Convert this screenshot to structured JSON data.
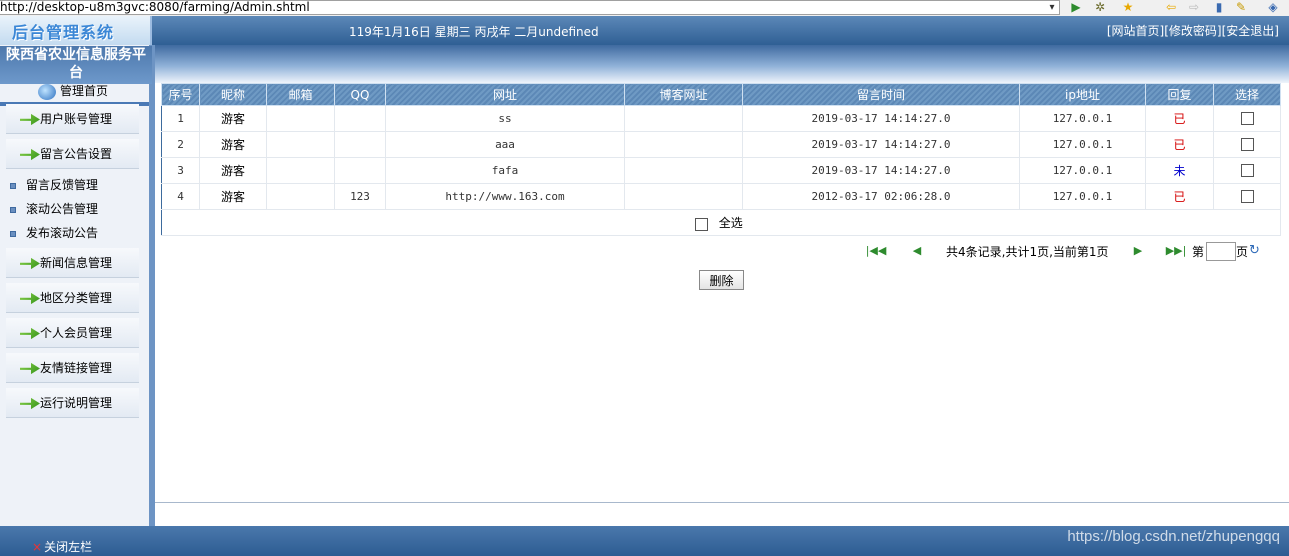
{
  "browser": {
    "address": "http://desktop-u8m3gvc:8080/farming/Admin.shtml",
    "address_dropdown": "▾",
    "toolbar_icons": [
      "go-icon",
      "settings-icon",
      "favorites-icon",
      "back-icon",
      "forward-icon",
      "page-icon",
      "tools-icon",
      "help-icon"
    ]
  },
  "header": {
    "logo": "后台管理系统",
    "date_line": "119年1月16日 星期三 丙戌年 二月undefined",
    "links": [
      "[网站首页]",
      "[修改密码]",
      "[安全退出]"
    ]
  },
  "sidebar": {
    "site_name": "陕西省农业信息服务平台",
    "home_label": "管理首页",
    "menu": [
      {
        "label": "用户账号管理"
      },
      {
        "label": "留言公告设置"
      }
    ],
    "sub_items": [
      "留言反馈管理",
      "滚动公告管理",
      "发布滚动公告"
    ],
    "menu_more": [
      "新闻信息管理",
      "地区分类管理",
      "个人会员管理",
      "友情链接管理",
      "运行说明管理"
    ]
  },
  "table": {
    "headers": [
      "序号",
      "昵称",
      "邮箱",
      "QQ",
      "网址",
      "博客网址",
      "留言时间",
      "ip地址",
      "回复",
      "选择"
    ],
    "rows": [
      {
        "no": "1",
        "nick": "游客",
        "email": "",
        "qq": "",
        "url": "ss",
        "blog": "",
        "time": "2019-03-17 14:14:27.0",
        "ip": "127.0.0.1",
        "reply": "已",
        "reply_color": "#d40000"
      },
      {
        "no": "2",
        "nick": "游客",
        "email": "",
        "qq": "",
        "url": "aaa",
        "blog": "",
        "time": "2019-03-17 14:14:27.0",
        "ip": "127.0.0.1",
        "reply": "已",
        "reply_color": "#d40000"
      },
      {
        "no": "3",
        "nick": "游客",
        "email": "",
        "qq": "",
        "url": "fafa",
        "blog": "",
        "time": "2019-03-17 14:14:27.0",
        "ip": "127.0.0.1",
        "reply": "未",
        "reply_color": "#0000cc"
      },
      {
        "no": "4",
        "nick": "游客",
        "email": "",
        "qq": "123",
        "url": "http://www.163.com",
        "blog": "",
        "time": "2012-03-17 02:06:28.0",
        "ip": "127.0.0.1",
        "reply": "已",
        "reply_color": "#d40000"
      }
    ],
    "select_all_label": "全选"
  },
  "pager": {
    "summary": "共4条记录,共计1页,当前第1页",
    "page_prefix": "第",
    "page_suffix": "页",
    "page_value": ""
  },
  "actions": {
    "delete_label": "删除"
  },
  "footer": {
    "close_left": "关闭左栏",
    "close_icon": "×",
    "watermark": "https://blog.csdn.net/zhupengqq"
  },
  "colors": {
    "header_blue": "#2f5f94",
    "table_header": "#6f9ac4",
    "replied": "#d40000",
    "not_replied": "#0000cc"
  }
}
